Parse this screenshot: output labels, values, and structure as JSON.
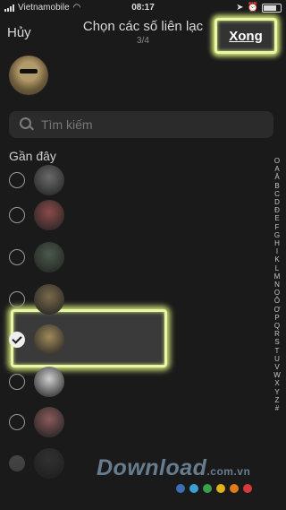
{
  "status_bar": {
    "carrier": "Vietnamobile",
    "time": "08:17",
    "battery_fill": 0.7
  },
  "nav": {
    "cancel_label": "Hủy",
    "title": "Chọn các số liên lạc",
    "subtitle": "3/4",
    "done_label": "Xong"
  },
  "search": {
    "placeholder": "Tìm kiếm"
  },
  "section": {
    "title": "Gần đây"
  },
  "contacts": [
    {
      "selected": false,
      "avatar_color": "#6a6a6a"
    },
    {
      "selected": false,
      "avatar_color": "#8a4a4a"
    },
    {
      "selected": false,
      "avatar_color": "#4a5a4a"
    },
    {
      "selected": false,
      "avatar_color": "#7a6a4a"
    },
    {
      "selected": true,
      "avatar_color": "#a08a5a"
    },
    {
      "selected": false,
      "avatar_color": "#cfcfcf"
    },
    {
      "selected": false,
      "avatar_color": "#8a5a5a"
    },
    {
      "selected": true,
      "avatar_color": "#3a3a3a"
    }
  ],
  "index_letters": [
    "O",
    "A",
    "Ă",
    "B",
    "C",
    "D",
    "Đ",
    "E",
    "F",
    "G",
    "H",
    "I",
    "K",
    "L",
    "M",
    "N",
    "O",
    "Ô",
    "Ơ",
    "P",
    "Q",
    "R",
    "S",
    "T",
    "U",
    "V",
    "W",
    "X",
    "Y",
    "Z",
    "#"
  ],
  "watermark": {
    "text": "Download",
    "suffix": ".com.vn",
    "dot_colors": [
      "#3a6fb5",
      "#39a0d6",
      "#3aa04a",
      "#e0b21a",
      "#e07a1a",
      "#d83a3a"
    ]
  }
}
